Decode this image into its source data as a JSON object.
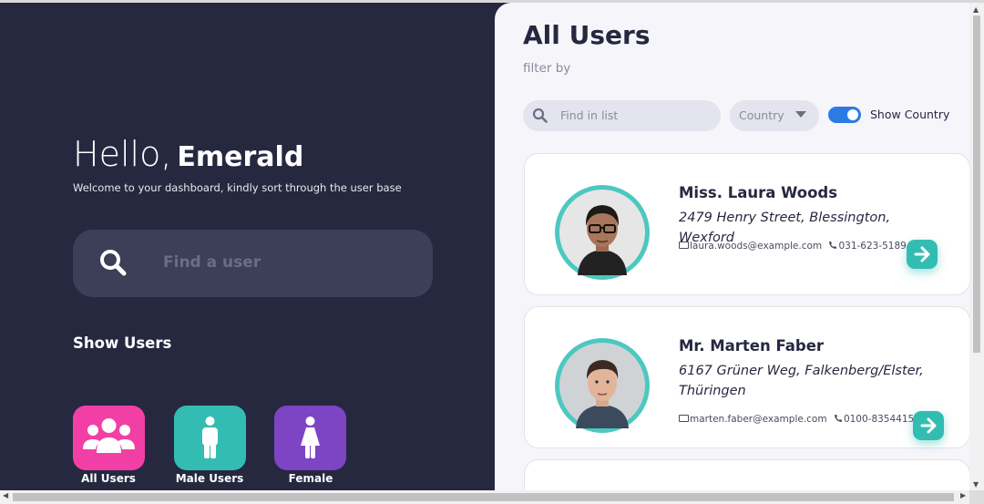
{
  "sidebar": {
    "greeting": "Hello,",
    "user_name": "Emerald",
    "welcome_text": "Welcome to your dashboard, kindly sort through the user base",
    "search_placeholder": "Find a user",
    "show_users_heading": "Show Users",
    "buttons": [
      {
        "label": "All Users",
        "icon": "users-group-icon",
        "color": "#f23fa6"
      },
      {
        "label": "Male Users",
        "icon": "male-icon",
        "color": "#33bdb2"
      },
      {
        "label": "Female",
        "icon": "female-icon",
        "color": "#7d44c4"
      }
    ]
  },
  "main": {
    "title": "All Users",
    "subtitle": "filter by",
    "find_placeholder": "Find in list",
    "country_select": "Country",
    "toggle_label": "Show Country",
    "toggle_on": true,
    "users": [
      {
        "name": "Miss. Laura Woods",
        "address": "2479 Henry Street, Blessington, Wexford",
        "email": "laura.woods@example.com",
        "phone": "031-623-5189"
      },
      {
        "name": "Mr. Marten Faber",
        "address": "6167 Grüner Weg, Falkenberg/Elster, Thüringen",
        "email": "marten.faber@example.com",
        "phone": "0100-8354415"
      }
    ]
  },
  "colors": {
    "sidebar_bg": "#262840",
    "accent_teal": "#33bdb2",
    "accent_pink": "#f23fa6",
    "accent_purple": "#7d44c4",
    "toggle_blue": "#2c7be5"
  }
}
